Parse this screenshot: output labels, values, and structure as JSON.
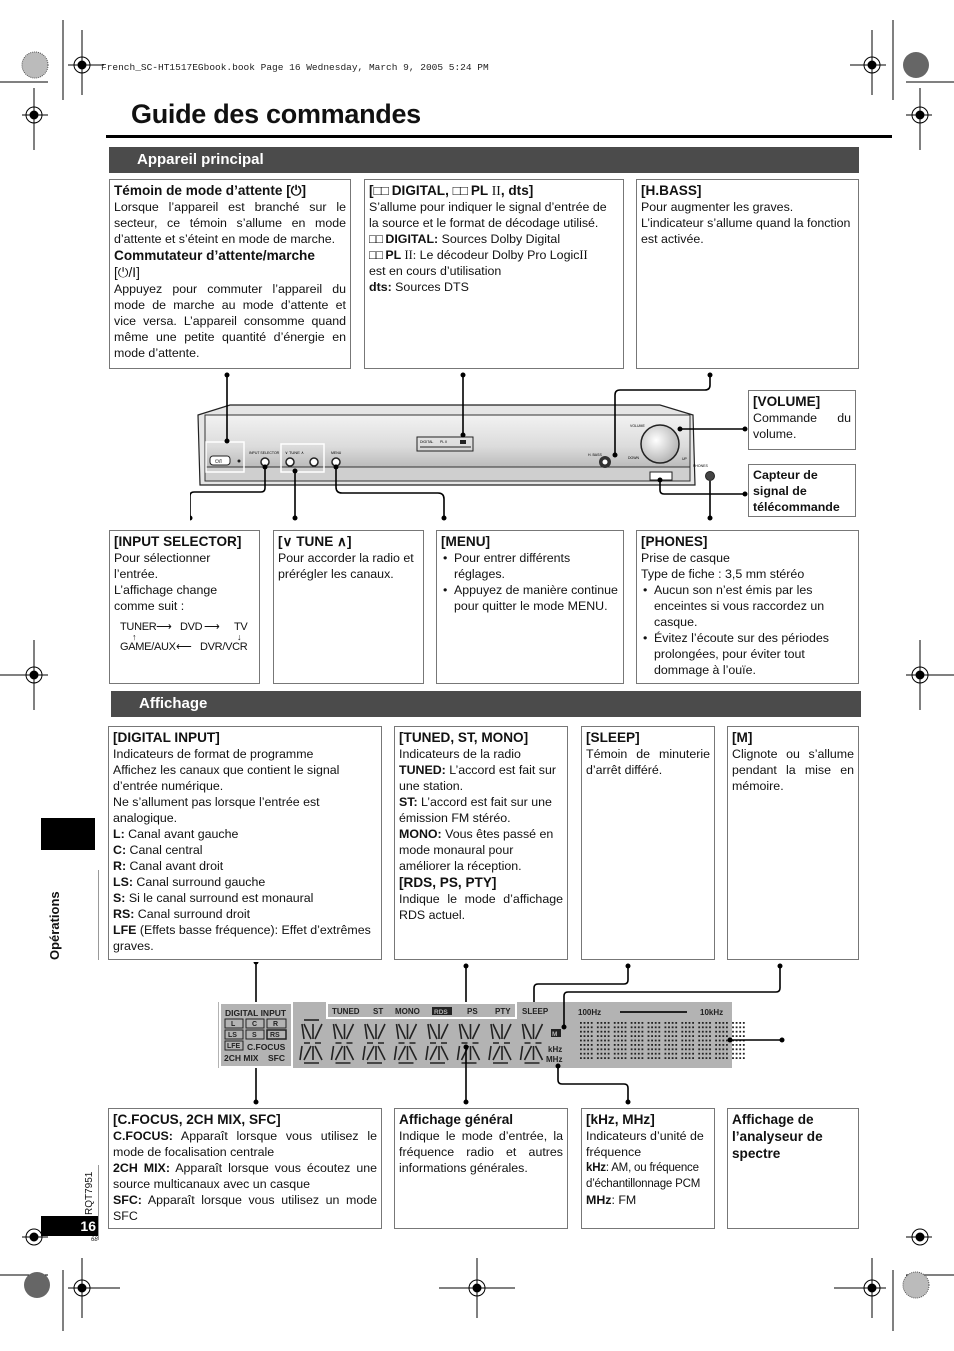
{
  "header": {
    "file_info": "French_SC-HT1517EGbook.book  Page 16  Wednesday, March 9, 2005  5:24 PM"
  },
  "title": "Guide des commandes",
  "sections": {
    "main_unit": "Appareil principal",
    "display": "Affichage"
  },
  "main_unit_boxes": {
    "standby": {
      "title": "Témoin de mode d’attente [⏻]",
      "text": "Lorsque l’appareil est branché sur le secteur, ce témoin s’allume en mode d’attente et s’éteint en mode de marche.",
      "title2": "Commutateur d’attente/marche",
      "title2b": "[⏻/I]",
      "text2": "Appuyez pour commuter l’appareil du mode de marche au mode d’attente et vice versa. L’appareil consomme quand même une petite quantité d’énergie en mode d’attente."
    },
    "decoder": {
      "title_prefix": "[",
      "dolby_glyph": "□□",
      "title_digital": " DIGITAL, ",
      "title_pl": " PL ",
      "title_roman": "II",
      "title_suffix": ", dts]",
      "text": "S’allume pour indiquer le signal d’entrée de la source et le format de décodage utilisé.",
      "digital_label": " DIGITAL:",
      "digital_text": " Sources Dolby Digital",
      "pl_label": " PL ",
      "pl_roman": "II:",
      "pl_text": " Le décodeur Dolby Pro Logic",
      "pl_text_roman": "II",
      "pl_text2": "est en cours d’utilisation",
      "dts_label": "dts:",
      "dts_text": " Sources DTS"
    },
    "hbass": {
      "title": "[H.BASS]",
      "text": "Pour augmenter les graves.",
      "text2": "L’indicateur s’allume quand la fonction est activée."
    },
    "volume": {
      "title": "[VOLUME]",
      "text": "Commande du volume."
    },
    "remote_sensor": {
      "title": "Capteur de signal de télécommande"
    },
    "input_selector": {
      "title": "[INPUT SELECTOR]",
      "text": "Pour sélectionner l’entrée.",
      "text2": "L’affichage change comme suit :",
      "flow": [
        "TUNER",
        "DVD",
        "TV",
        "DVR/VCR",
        "GAME/AUX"
      ]
    },
    "tune": {
      "title": "[∨ TUNE ∧]",
      "text": "Pour accorder la radio et prérégler les canaux."
    },
    "menu": {
      "title": "[MENU]",
      "bullets": [
        "Pour entrer différents réglages.",
        "Appuyez de manière continue pour quitter le mode MENU."
      ]
    },
    "phones": {
      "title": "[PHONES]",
      "text": "Prise de casque",
      "text2": "Type de fiche : 3,5 mm stéréo",
      "bullets": [
        "Aucun son n’est émis par les enceintes si vous raccordez un casque.",
        "Évitez l’écoute sur des périodes prolongées, pour éviter tout dommage à l’ouïe."
      ]
    }
  },
  "device_labels": {
    "standby_btn": "⏻/I",
    "input_selector": "INPUT SELECTOR",
    "tune": "∨  TUNE  ∧",
    "menu": "MENU",
    "digital": "DIGITAL",
    "pl": "PL II",
    "dts": "dts",
    "hbass": "H. BASS",
    "volume": "VOLUME",
    "down": "DOWN",
    "up": "UP",
    "phones": "PHONES"
  },
  "display_boxes": {
    "digital_input": {
      "title": "[DIGITAL INPUT]",
      "lines": [
        "Indicateurs de format de programme",
        "Affichez les canaux que contient le signal d’entrée numérique.",
        "Ne s’allument pas lorsque l’entrée est analogique."
      ],
      "items": [
        {
          "label": "L:",
          "text": " Canal avant gauche"
        },
        {
          "label": "C:",
          "text": " Canal central"
        },
        {
          "label": "R:",
          "text": " Canal avant droit"
        },
        {
          "label": "LS:",
          "text": " Canal surround gauche"
        },
        {
          "label": "S:",
          "text": " Si le canal surround est monaural"
        },
        {
          "label": "RS:",
          "text": " Canal surround droit"
        },
        {
          "label": "LFE",
          "text": " (Effets basse fréquence): Effet d’extrêmes graves."
        }
      ]
    },
    "tuned": {
      "title": "[TUNED, ST, MONO]",
      "text": "Indicateurs de la radio",
      "items": [
        {
          "label": "TUNED:",
          "text": " L’accord est fait sur une station."
        },
        {
          "label": "ST:",
          "text": " L’accord est fait sur une émission FM stéréo."
        },
        {
          "label": "MONO:",
          "text": " Vous êtes passé en mode monaural pour améliorer la réception."
        }
      ],
      "title2": "[RDS, PS, PTY]",
      "text2": "Indique le mode d’affichage RDS actuel."
    },
    "sleep": {
      "title": "[SLEEP]",
      "text": "Témoin de minuterie d’arrêt différé."
    },
    "m": {
      "title": "[M]",
      "text": "Clignote ou s’allume pendant la mise en mémoire."
    },
    "cfocus": {
      "title": "[C.FOCUS, 2CH MIX, SFC]",
      "items": [
        {
          "label": "C.FOCUS:",
          "text": " Apparaît lorsque vous utilisez le mode de focalisation centrale"
        },
        {
          "label": "2CH MIX:",
          "text": " Apparaît lorsque vous écoutez une source multicanaux avec un casque"
        },
        {
          "label": "SFC:",
          "text": " Apparaît lorsque vous utilisez un mode SFC"
        }
      ]
    },
    "general": {
      "title": "Affichage général",
      "text": "Indique le mode d’entrée, la fréquence radio et autres informations générales."
    },
    "khz": {
      "title": "[kHz, MHz]",
      "text": "Indicateurs d’unité de fréquence",
      "khz_label": "kHz",
      "khz_text": ": AM, ou fréquence d’échantillonnage PCM",
      "mhz_label": "MHz",
      "mhz_text": ": FM"
    },
    "spectrum": {
      "title": "Affichage de l’analyseur de spectre"
    }
  },
  "lcd_labels": {
    "digital_input": "DIGITAL INPUT",
    "ch_l": "L",
    "ch_c": "C",
    "ch_r": "R",
    "ch_ls": "LS",
    "ch_s": "S",
    "ch_rs": "RS",
    "ch_lfe": "LFE",
    "cfocus": "C.FOCUS",
    "mix": "2CH MIX",
    "sfc": "SFC",
    "tuned": "TUNED",
    "st": "ST",
    "mono": "MONO",
    "rds": "RDS",
    "ps": "PS",
    "pty": "PTY",
    "sleep": "SLEEP",
    "m": "M",
    "khz": "kHz",
    "mhz": "MHz",
    "f_low": "100Hz",
    "f_high": "10kHz"
  },
  "sidebar": {
    "tab_label": "Opérations",
    "doc_code": "RQT7951",
    "page_number": "16",
    "small_number": "68"
  }
}
